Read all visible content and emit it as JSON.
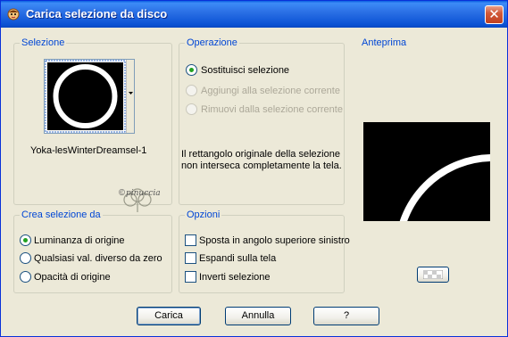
{
  "window": {
    "title": "Carica selezione da disco",
    "close_glyph": "✕"
  },
  "selezione": {
    "label": "Selezione",
    "filename": "Yoka-lesWinterDreamsel-1",
    "watermark": "©pinuccia"
  },
  "operazione": {
    "label": "Operazione",
    "options": [
      {
        "label": "Sostituisci selezione",
        "selected": true,
        "enabled": true
      },
      {
        "label": "Aggiungi alla selezione corrente",
        "selected": false,
        "enabled": false
      },
      {
        "label": "Rimuovi dalla selezione corrente",
        "selected": false,
        "enabled": false
      }
    ],
    "message_line1": "Il rettangolo originale della selezione",
    "message_line2": "non interseca completamente la tela."
  },
  "anteprima": {
    "label": "Anteprima"
  },
  "crea": {
    "label": "Crea selezione da",
    "options": [
      {
        "label": "Luminanza di origine",
        "selected": true
      },
      {
        "label": "Qualsiasi val. diverso da zero",
        "selected": false
      },
      {
        "label": "Opacità di origine",
        "selected": false
      }
    ]
  },
  "opzioni": {
    "label": "Opzioni",
    "checks": [
      {
        "label": "Sposta in angolo superiore sinistro",
        "checked": false
      },
      {
        "label": "Espandi sulla tela",
        "checked": false
      },
      {
        "label": "Inverti selezione",
        "checked": false
      }
    ]
  },
  "buttons": {
    "load": "Carica",
    "cancel": "Annulla",
    "help": "?"
  },
  "colors": {
    "title_bar": "#0A5FE0",
    "group_label": "#0046D5",
    "dialog_bg": "#ECE9D8",
    "radio_dot": "#21A121"
  }
}
